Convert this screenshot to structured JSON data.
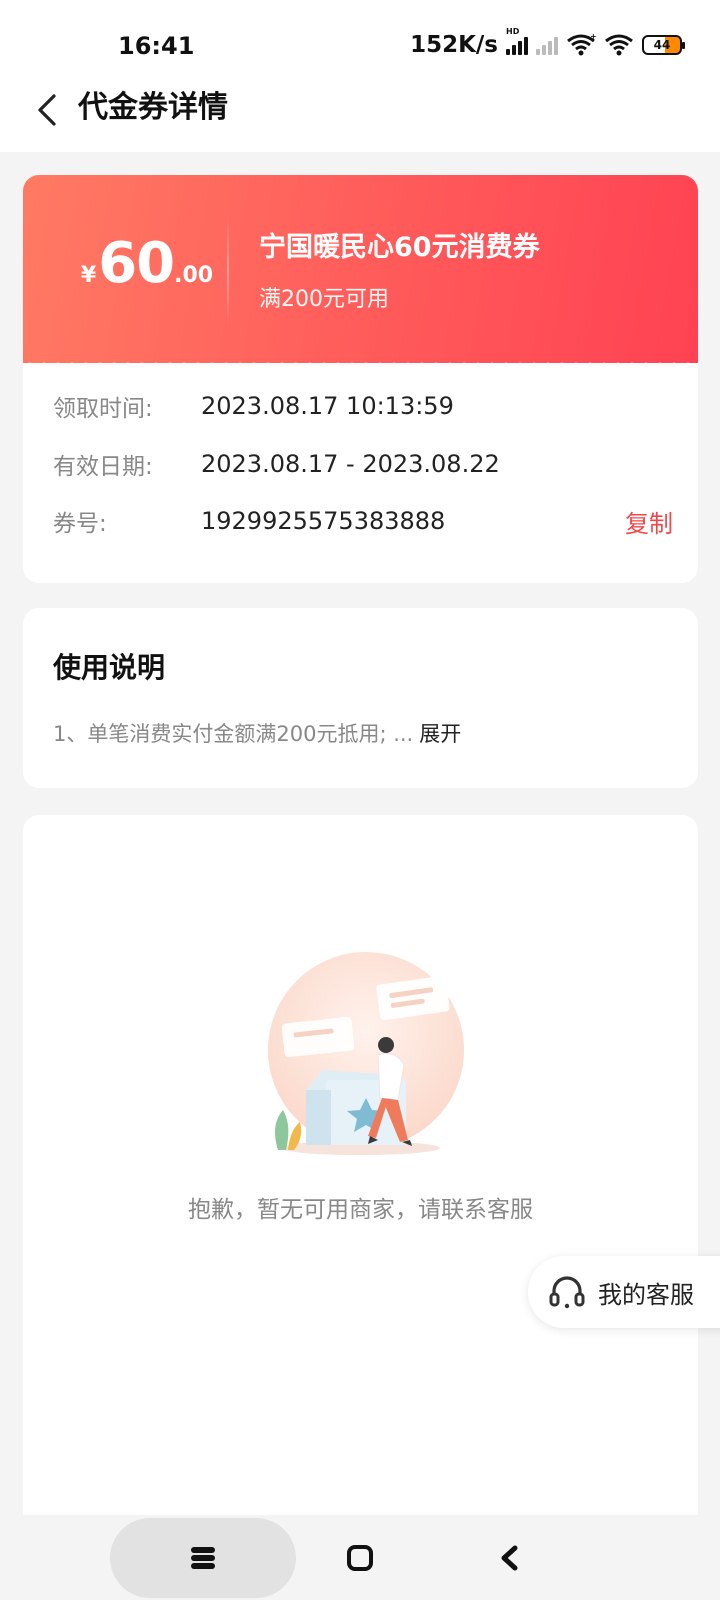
{
  "status_bar": {
    "time": "16:41",
    "net_speed": "152K/s",
    "signal_tag": "HD",
    "battery": "44"
  },
  "header": {
    "title": "代金券详情"
  },
  "coupon": {
    "currency": "¥",
    "amount_int": "60",
    "amount_dec": ".00",
    "name": "宁国暖民心60元消费券",
    "condition": "满200元可用",
    "rows": [
      {
        "label": "领取时间:",
        "value": "2023.08.17 10:13:59"
      },
      {
        "label": "有效日期:",
        "value": "2023.08.17 - 2023.08.22"
      },
      {
        "label": "券号:",
        "value": "1929925575383888"
      }
    ],
    "copy_label": "复制",
    "colors": {
      "gradient_start": "#ff7a63",
      "gradient_end": "#ff4253",
      "accent": "#f04848"
    }
  },
  "usage": {
    "title": "使用说明",
    "text": "1、单笔消费实付金额满200元抵用; ...",
    "expand_label": "展开"
  },
  "merchants": {
    "empty_text": "抱歉，暂无可用商家，请联系客服",
    "illustration_icon": "empty-gift-box-illustration"
  },
  "service": {
    "label": "我的客服",
    "icon": "headset-icon"
  },
  "nav": {
    "recents_icon": "menu-icon",
    "home_icon": "home-square-icon",
    "back_icon": "back-chevron-icon"
  }
}
